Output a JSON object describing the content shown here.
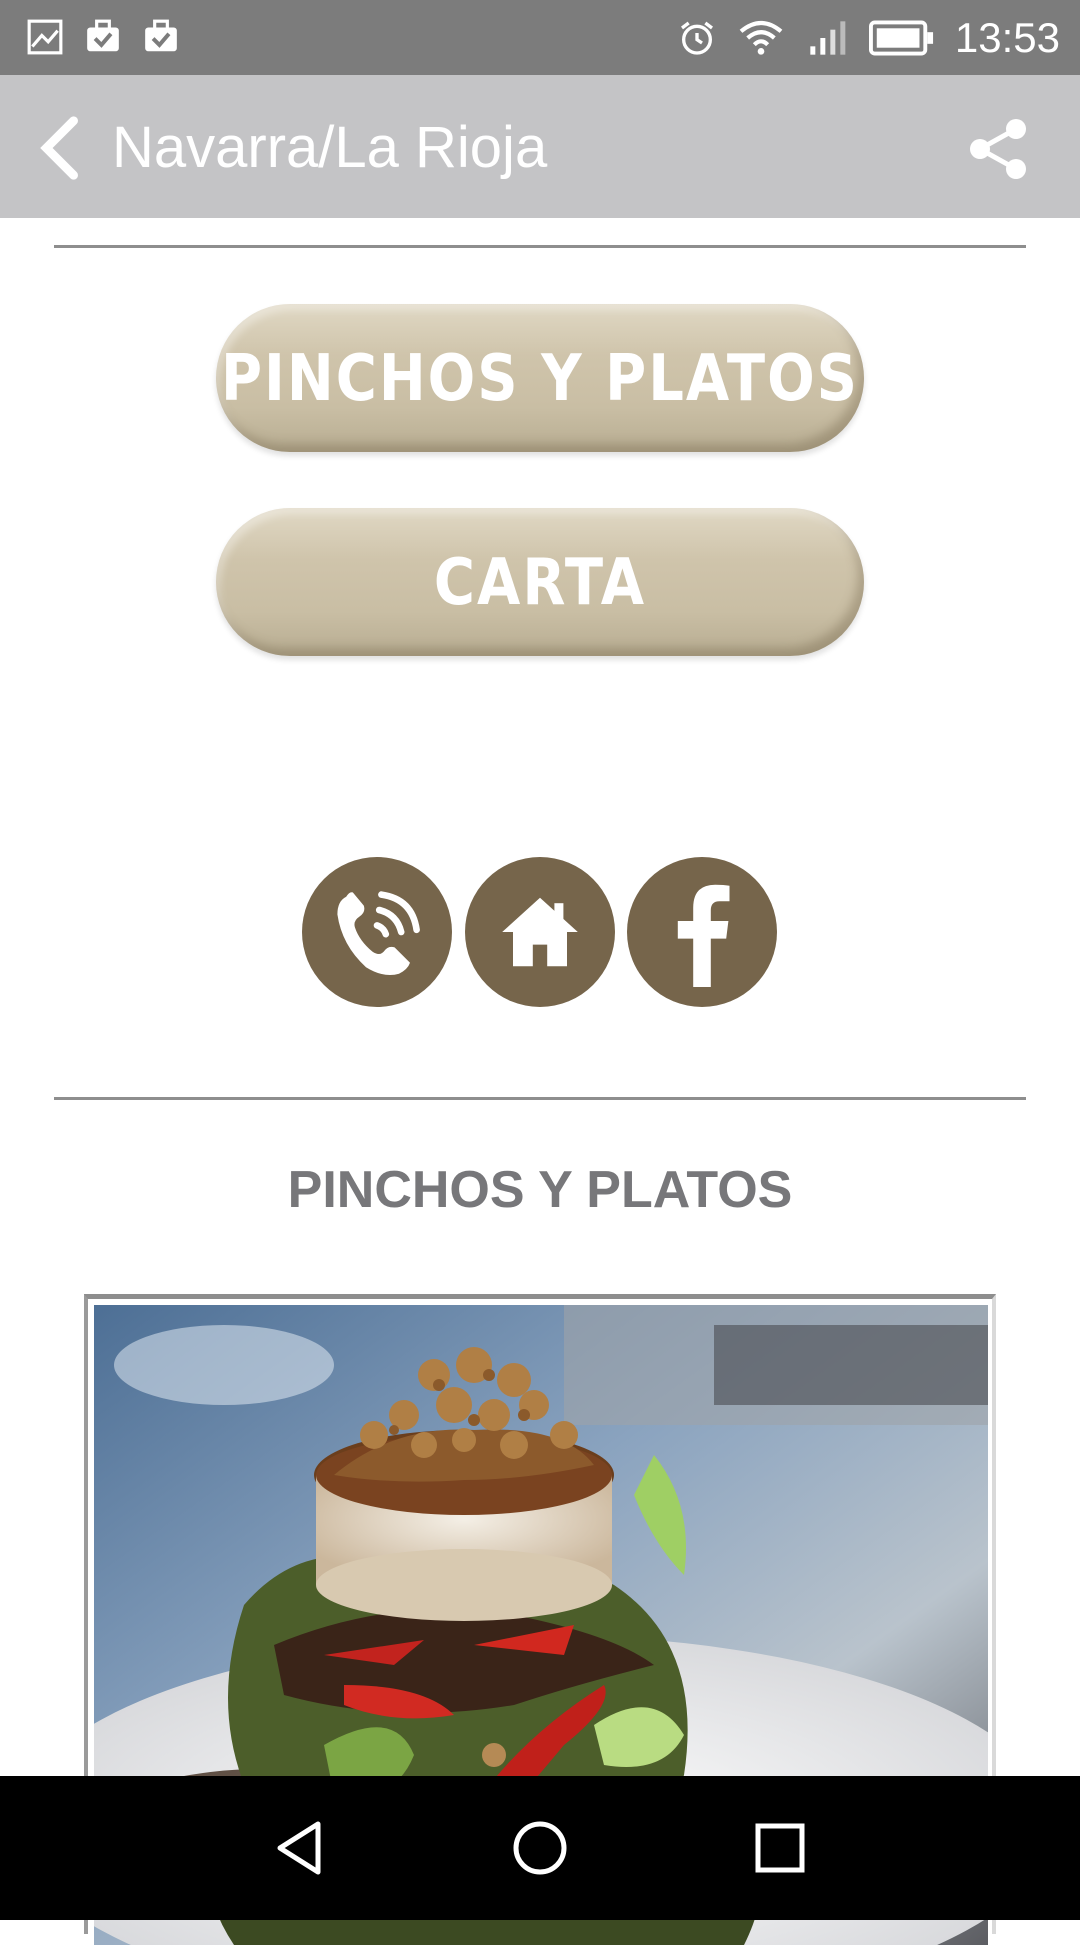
{
  "status_bar": {
    "time": "13:53",
    "left_icons": [
      "gallery-icon",
      "briefcase-check-icon",
      "briefcase-check-icon"
    ],
    "right_icons": [
      "alarm-icon",
      "wifi-icon",
      "signal-icon",
      "battery-icon"
    ]
  },
  "app_bar": {
    "title": "Navarra/La Rioja",
    "back_icon": "back-chevron-icon",
    "share_icon": "share-icon"
  },
  "buttons": {
    "pinchos": "PINCHOS Y PLATOS",
    "carta": "CARTA"
  },
  "contact_icons": [
    "phone-icon",
    "home-icon",
    "facebook-icon"
  ],
  "section": {
    "title": "PINCHOS Y PLATOS"
  },
  "nav_bar": {
    "icons": [
      "nav-back-icon",
      "nav-home-icon",
      "nav-recents-icon"
    ]
  },
  "colors": {
    "status_bar": "#7c7c7c",
    "app_bar": "#c4c4c6",
    "pill": "#cfc4ab",
    "circle_button": "#76654b",
    "section_title": "#77777a"
  }
}
